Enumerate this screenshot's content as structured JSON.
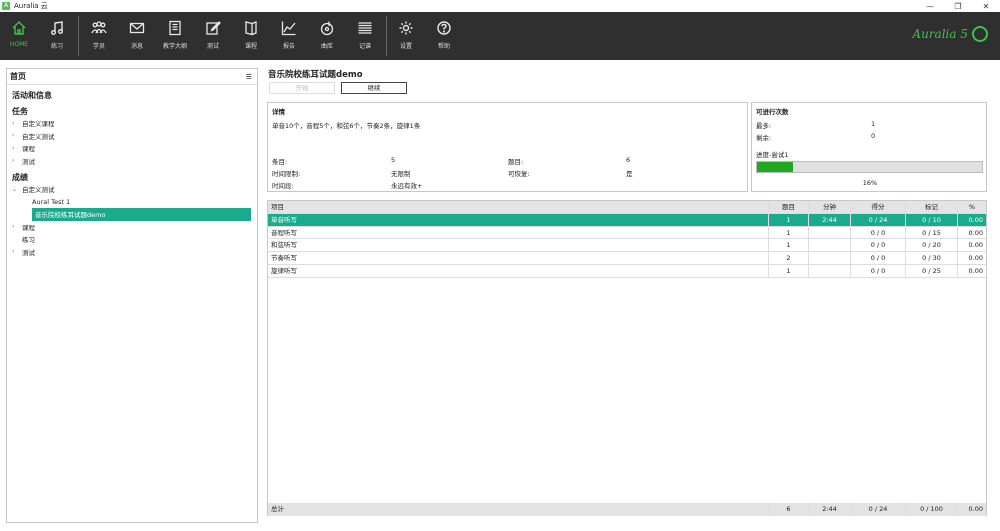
{
  "window": {
    "title": "Auralia 云"
  },
  "toolbar": {
    "items": [
      {
        "label": "HOME"
      },
      {
        "label": "练习"
      },
      {
        "label": "学员"
      },
      {
        "label": "消息"
      },
      {
        "label": "教学大纲"
      },
      {
        "label": "测试"
      },
      {
        "label": "课程"
      },
      {
        "label": "报告"
      },
      {
        "label": "曲库"
      },
      {
        "label": "记谱"
      },
      {
        "label": "设置"
      },
      {
        "label": "帮助"
      }
    ],
    "brand": "Auralia 5"
  },
  "sidebar": {
    "title": "首页",
    "section_activity": "活动和信息",
    "section_tasks": "任务",
    "task_items": [
      "自定义课程",
      "自定义测试",
      "课程",
      "测试"
    ],
    "section_grades": "成绩",
    "grade_custom_test": "自定义测试",
    "grade_children": [
      "Aural Test 1",
      "音乐院校练耳试题demo"
    ],
    "grade_course": "课程",
    "grade_practice": "练习",
    "grade_test": "测试"
  },
  "main": {
    "title": "音乐院校练耳试题demo",
    "tab_start": "开始",
    "tab_continue": "继续",
    "details": {
      "title": "详情",
      "description": "单音10个，音程5个，和弦6个，节奏2条，旋律1条",
      "items_label": "条目:",
      "items_value": "5",
      "questions_label": "题目:",
      "questions_value": "6",
      "time_limit_label": "时间限制:",
      "time_limit_value": "无限制",
      "resumable_label": "可恢复:",
      "resumable_value": "是",
      "period_label": "时间段:",
      "period_value": "永远有效+"
    },
    "attempts": {
      "title": "可进行次数",
      "max_label": "最多:",
      "max_value": "1",
      "remaining_label": "剩余:",
      "remaining_value": "0",
      "progress_label": "进度-尝试1",
      "progress_percent": 16,
      "progress_text": "16%"
    },
    "table": {
      "headers": [
        "项目",
        "题目",
        "分钟",
        "得分",
        "标记",
        "%"
      ],
      "rows": [
        [
          "单音听写",
          "1",
          "2:44",
          "0 / 24",
          "0 / 10",
          "0.00"
        ],
        [
          "音程听写",
          "1",
          "",
          "0 / 0",
          "0 / 15",
          "0.00"
        ],
        [
          "和弦听写",
          "1",
          "",
          "0 / 0",
          "0 / 20",
          "0.00"
        ],
        [
          "节奏听写",
          "2",
          "",
          "0 / 0",
          "0 / 30",
          "0.00"
        ],
        [
          "旋律听写",
          "1",
          "",
          "0 / 0",
          "0 / 25",
          "0.00"
        ]
      ],
      "footer": [
        "总计",
        "6",
        "2:44",
        "0 / 24",
        "0 / 100",
        "0.00"
      ]
    }
  }
}
